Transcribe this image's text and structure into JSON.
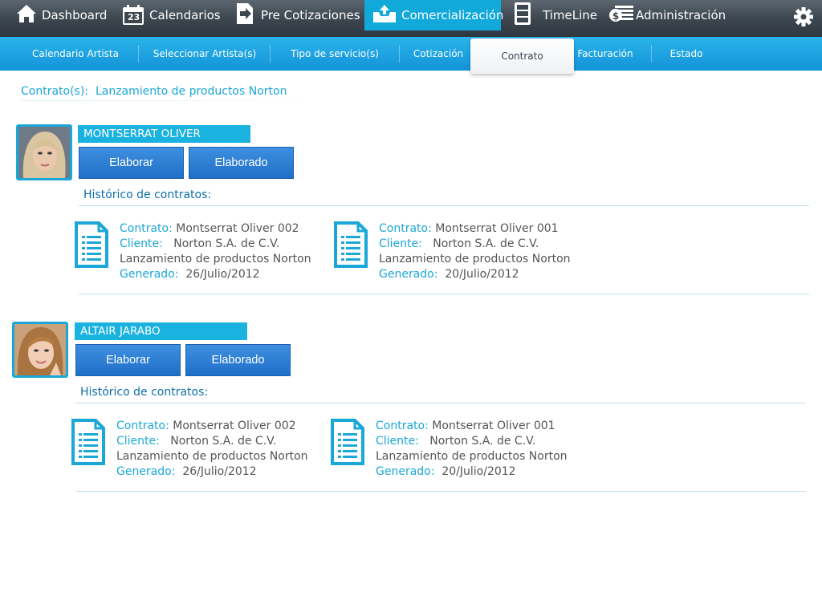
{
  "topnav": {
    "items": [
      {
        "label": "Dashboard",
        "icon": "home-icon"
      },
      {
        "label": "Calendarios",
        "icon": "calendar-icon",
        "calendar_day": "23"
      },
      {
        "label": "Pre Cotizaciones",
        "icon": "document-arrow-icon"
      },
      {
        "label": "Comercialización",
        "icon": "inbox-upload-icon",
        "active": true
      },
      {
        "label": "TimeLine",
        "icon": "cabinet-icon"
      },
      {
        "label": "Administración",
        "icon": "money-icon"
      }
    ],
    "settings_icon": "gear-icon"
  },
  "subnav": {
    "items": [
      {
        "label": "Calendario Artista"
      },
      {
        "label": "Seleccionar Artista(s)"
      },
      {
        "label": "Tipo de servicio(s)"
      },
      {
        "label": "Cotización"
      },
      {
        "label": "Contrato",
        "active": true
      },
      {
        "label": "Facturación"
      },
      {
        "label": "Estado"
      }
    ]
  },
  "page": {
    "label": "Contrato(s):",
    "project": "Lanzamiento de productos Norton"
  },
  "labels": {
    "elaborar": "Elaborar",
    "elaborado": "Elaborado",
    "historico": "Histórico de contratos:",
    "contrato": "Contrato:",
    "cliente": "Cliente:",
    "generado": "Generado:"
  },
  "artists": [
    {
      "name": "MONTSERRAT OLIVER",
      "contracts": [
        {
          "contrato": "Montserrat Oliver 002",
          "cliente": "Norton S.A. de C.V.",
          "proyecto": "Lanzamiento de productos Norton",
          "generado": "26/Julio/2012"
        },
        {
          "contrato": "Montserrat Oliver 001",
          "cliente": "Norton S.A. de C.V.",
          "proyecto": "Lanzamiento de productos Norton",
          "generado": "20/Julio/2012"
        }
      ]
    },
    {
      "name": "ALTAIR JARABO",
      "contracts": [
        {
          "contrato": "Montserrat Oliver 002",
          "cliente": "Norton S.A. de C.V.",
          "proyecto": "Lanzamiento de productos Norton",
          "generado": "26/Julio/2012"
        },
        {
          "contrato": "Montserrat Oliver 001",
          "cliente": "Norton S.A. de C.V.",
          "proyecto": "Lanzamiento de productos Norton",
          "generado": "20/Julio/2012"
        }
      ]
    }
  ],
  "colors": {
    "accent": "#1ba7d8",
    "nav_dark": "#3d4750",
    "subnav": "#1393d8",
    "button": "#2a7fd6"
  }
}
